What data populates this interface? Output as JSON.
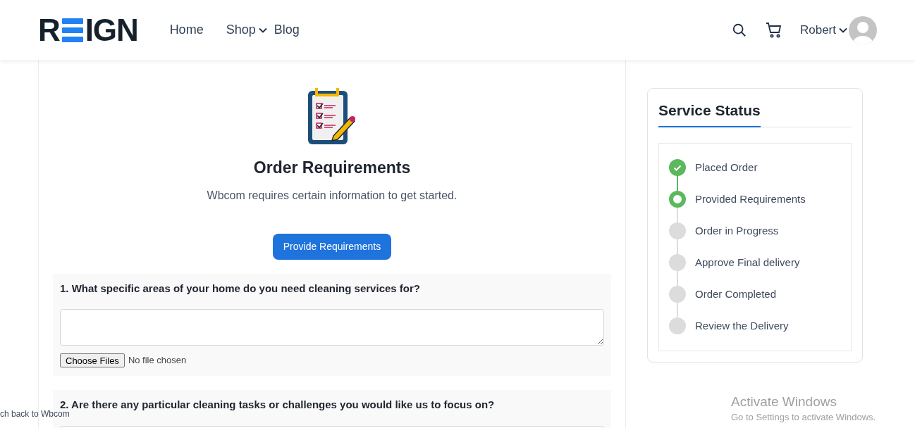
{
  "header": {
    "logo": {
      "left": "R",
      "right": "IGN"
    },
    "nav": [
      {
        "label": "Home",
        "dropdown": false
      },
      {
        "label": "Shop",
        "dropdown": true
      },
      {
        "label": "Blog",
        "dropdown": false
      }
    ],
    "user": {
      "name": "Robert"
    }
  },
  "order": {
    "title": "Order Requirements",
    "subtitle": "Wbcom requires certain information to get started.",
    "button": "Provide Requirements",
    "questions": [
      {
        "label": "1. What specific areas of your home do you need cleaning services for?",
        "file_button": "Choose Files",
        "file_status": "No file chosen"
      },
      {
        "label": "2. Are there any particular cleaning tasks or challenges you would like us to focus on?"
      }
    ]
  },
  "sidebar": {
    "title": "Service Status",
    "steps": [
      {
        "label": "Placed Order",
        "kind": "done"
      },
      {
        "label": "Provided Requirements",
        "kind": "current"
      },
      {
        "label": "Order in Progress",
        "kind": "pending"
      },
      {
        "label": "Approve Final delivery",
        "kind": "pending"
      },
      {
        "label": "Order Completed",
        "kind": "pending"
      },
      {
        "label": "Review the Delivery",
        "kind": "pending"
      }
    ]
  },
  "switch_back_link": "ch back to Wbcom",
  "os_notice": {
    "title": "Activate Windows",
    "text": "Go to Settings to activate Windows."
  }
}
